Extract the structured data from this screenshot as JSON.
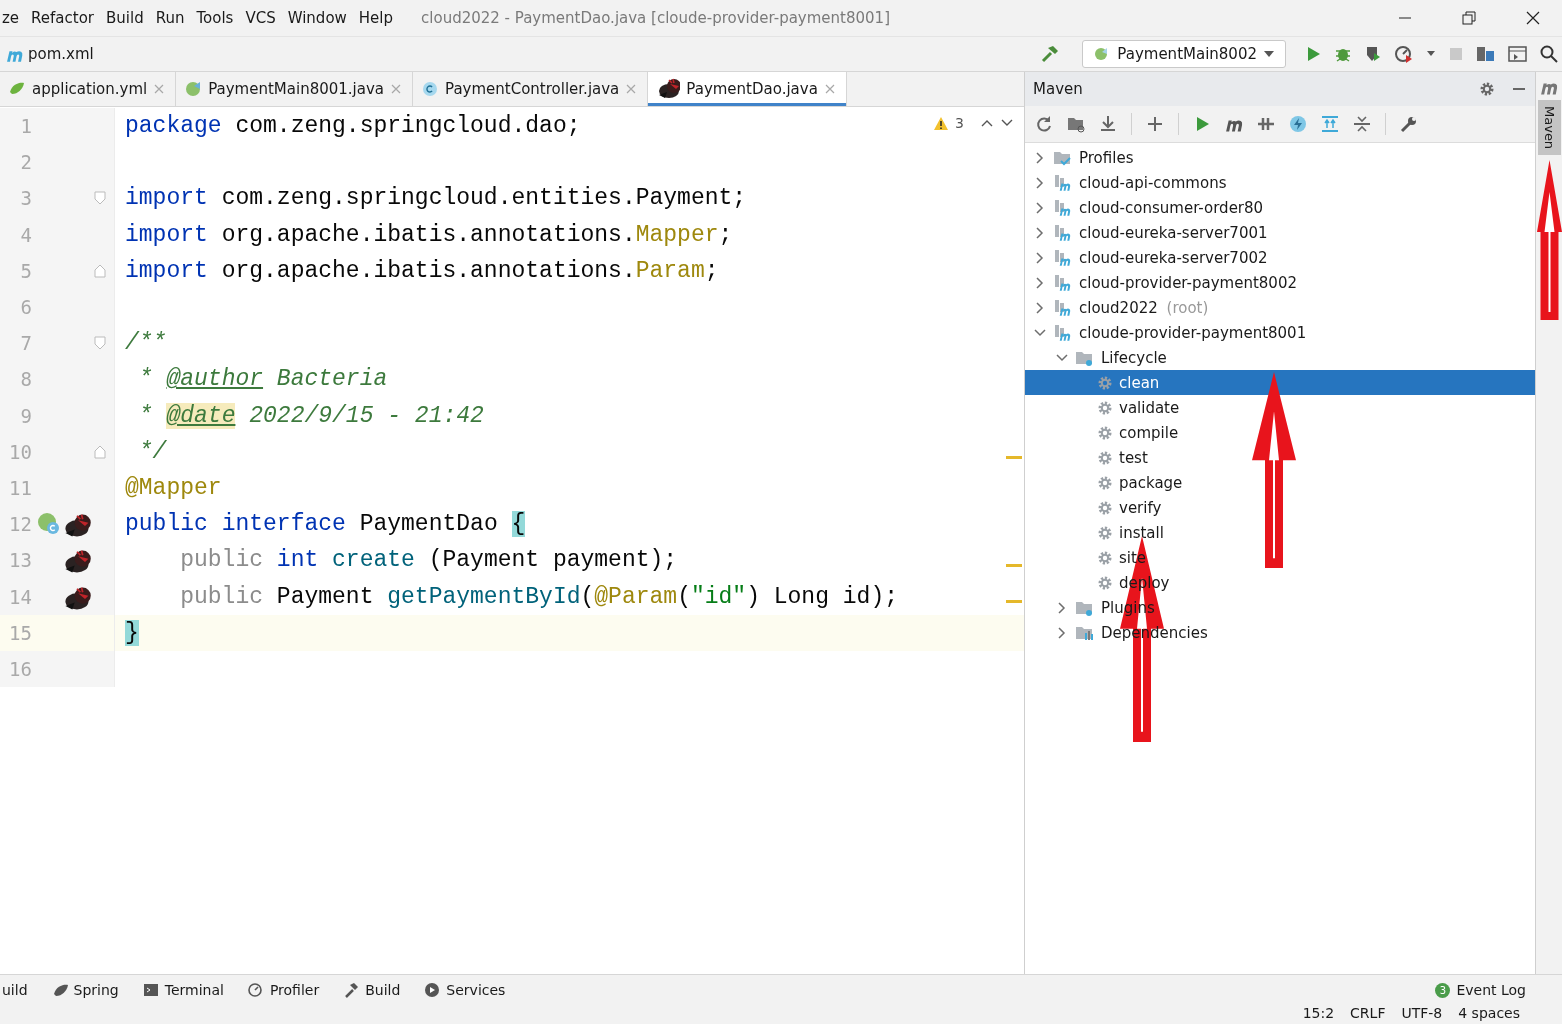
{
  "menu": [
    "ze",
    "Refactor",
    "Build",
    "Run",
    "Tools",
    "VCS",
    "Window",
    "Help"
  ],
  "window": {
    "title": "cloud2022 - PaymentDao.java [cloude-provider-payment8001]"
  },
  "nav": {
    "file": "pom.xml",
    "run_config": "PaymentMain8002"
  },
  "tabs": [
    {
      "label": "application.yml",
      "kind": "yml",
      "selected": false
    },
    {
      "label": "PaymentMain8001.java",
      "kind": "app",
      "selected": false
    },
    {
      "label": "PaymentController.java",
      "kind": "class",
      "selected": false
    },
    {
      "label": "PaymentDao.java",
      "kind": "mapper",
      "selected": true
    }
  ],
  "editor": {
    "warnings": "3",
    "lines": [
      {
        "num": "1",
        "tokens": [
          {
            "t": "package",
            "kind": "kw"
          },
          {
            "t": " com.zeng.springcloud.dao;",
            "kind": "plain"
          }
        ],
        "fold_open": false,
        "fold_close": false,
        "current": false,
        "stripe_mark": false
      },
      {
        "num": "2",
        "fold_open": false,
        "fold_close": false,
        "current": false,
        "stripe_mark": false
      },
      {
        "num": "3",
        "tokens": [
          {
            "t": "import",
            "kind": "kw"
          },
          {
            "t": " com.zeng.springcloud.entities.Payment;",
            "kind": "plain"
          }
        ],
        "fold_open": true,
        "fold_close": false,
        "current": false,
        "stripe_mark": false
      },
      {
        "num": "4",
        "tokens": [
          {
            "t": "import",
            "kind": "kw"
          },
          {
            "t": " org.apache.ibatis.annotations.",
            "kind": "plain"
          },
          {
            "t": "Mapper",
            "kind": "ann"
          },
          {
            "t": ";",
            "kind": "plain"
          }
        ],
        "fold_open": false,
        "fold_close": false,
        "current": false,
        "stripe_mark": false
      },
      {
        "num": "5",
        "tokens": [
          {
            "t": "import",
            "kind": "kw"
          },
          {
            "t": " org.apache.ibatis.annotations.",
            "kind": "plain"
          },
          {
            "t": "Param",
            "kind": "ann"
          },
          {
            "t": ";",
            "kind": "plain"
          }
        ],
        "fold_open": false,
        "fold_close": true,
        "current": false,
        "stripe_mark": false
      },
      {
        "num": "6",
        "fold_open": false,
        "fold_close": false,
        "current": false,
        "stripe_mark": false
      },
      {
        "num": "7",
        "tokens": [
          {
            "t": "/**",
            "kind": "doc"
          }
        ],
        "fold_open": true,
        "fold_close": false,
        "current": false,
        "stripe_mark": false
      },
      {
        "num": "8",
        "tokens": [
          {
            "t": " * ",
            "kind": "doc"
          },
          {
            "t": "@author",
            "kind": "doctag"
          },
          {
            "t": " Bacteria",
            "kind": "doc"
          }
        ],
        "fold_open": false,
        "fold_close": false,
        "current": false,
        "stripe_mark": false
      },
      {
        "num": "9",
        "tokens": [
          {
            "t": " * ",
            "kind": "doc"
          },
          {
            "t": "@date",
            "kind": "doctag-hl"
          },
          {
            "t": " 2022/9/15 - 21:42",
            "kind": "doc"
          }
        ],
        "fold_open": false,
        "fold_close": false,
        "current": false,
        "stripe_mark": false
      },
      {
        "num": "10",
        "tokens": [
          {
            "t": " */",
            "kind": "doc"
          }
        ],
        "fold_open": false,
        "fold_close": true,
        "current": false,
        "stripe_mark": true
      },
      {
        "num": "11",
        "tokens": [
          {
            "t": "@Mapper",
            "kind": "ann"
          }
        ],
        "fold_open": false,
        "fold_close": false,
        "current": false,
        "stripe_mark": false
      },
      {
        "num": "12",
        "tokens": [
          {
            "t": "public ",
            "kind": "kw"
          },
          {
            "t": "interface",
            "kind": "kw"
          },
          {
            "t": " PaymentDao ",
            "kind": "plain"
          },
          {
            "t": "{",
            "kind": "brace"
          }
        ],
        "gutter": [
          {
            "kind": "implemented"
          },
          {
            "kind": "mapper"
          }
        ],
        "fold_open": false,
        "fold_close": false,
        "current": false,
        "stripe_mark": false
      },
      {
        "num": "13",
        "tokens": [
          {
            "t": "    public ",
            "kind": "dim"
          },
          {
            "t": "int ",
            "kind": "kw"
          },
          {
            "t": "create",
            "kind": "method"
          },
          {
            "t": " (Payment payment);",
            "kind": "plain"
          }
        ],
        "gutter": [
          {
            "kind": "mapper"
          }
        ],
        "fold_open": false,
        "fold_close": false,
        "current": false,
        "stripe_mark": true
      },
      {
        "num": "14",
        "tokens": [
          {
            "t": "    public ",
            "kind": "dim"
          },
          {
            "t": "Payment ",
            "kind": "plain"
          },
          {
            "t": "getPaymentById",
            "kind": "method"
          },
          {
            "t": "(",
            "kind": "plain"
          },
          {
            "t": "@Param",
            "kind": "ann"
          },
          {
            "t": "(",
            "kind": "plain"
          },
          {
            "t": "\"id\"",
            "kind": "str"
          },
          {
            "t": ") Long id);",
            "kind": "plain"
          }
        ],
        "gutter": [
          {
            "kind": "mapper"
          }
        ],
        "fold_open": false,
        "fold_close": false,
        "current": false,
        "stripe_mark": true
      },
      {
        "num": "15",
        "tokens": [
          {
            "t": "}",
            "kind": "brace"
          }
        ],
        "fold_open": false,
        "fold_close": false,
        "current": true,
        "stripe_mark": false
      },
      {
        "num": "16",
        "fold_open": false,
        "fold_close": false,
        "current": false,
        "stripe_mark": false
      }
    ]
  },
  "maven": {
    "title": "Maven",
    "tree": [
      {
        "label": "Profiles",
        "kind": "profiles",
        "expanded": false,
        "selected": false
      },
      {
        "label": "cloud-api-commons",
        "kind": "module",
        "expanded": false,
        "selected": false
      },
      {
        "label": "cloud-consumer-order80",
        "kind": "module",
        "expanded": false,
        "selected": false
      },
      {
        "label": "cloud-eureka-server7001",
        "kind": "module",
        "expanded": false,
        "selected": false
      },
      {
        "label": "cloud-eureka-server7002",
        "kind": "module",
        "expanded": false,
        "selected": false
      },
      {
        "label": "cloud-provider-payment8002",
        "kind": "module",
        "expanded": false,
        "selected": false
      },
      {
        "label": "cloud2022",
        "note": "(root)",
        "kind": "module",
        "expanded": false,
        "selected": false
      },
      {
        "label": "cloude-provider-payment8001",
        "kind": "module",
        "expanded": true,
        "selected": false,
        "children": [
          {
            "label": "Lifecycle",
            "kind": "folder",
            "expanded": true,
            "selected": false,
            "children": [
              {
                "label": "clean",
                "kind": "goal",
                "selected": true
              },
              {
                "label": "validate",
                "kind": "goal",
                "selected": false
              },
              {
                "label": "compile",
                "kind": "goal",
                "selected": false
              },
              {
                "label": "test",
                "kind": "goal",
                "selected": false
              },
              {
                "label": "package",
                "kind": "goal",
                "selected": false
              },
              {
                "label": "verify",
                "kind": "goal",
                "selected": false
              },
              {
                "label": "install",
                "kind": "goal",
                "selected": false
              },
              {
                "label": "site",
                "kind": "goal",
                "selected": false
              },
              {
                "label": "deploy",
                "kind": "goal",
                "selected": false
              }
            ]
          },
          {
            "label": "Plugins",
            "kind": "folder",
            "expanded": false,
            "selected": false
          },
          {
            "label": "Dependencies",
            "kind": "deps",
            "expanded": false,
            "selected": false
          }
        ]
      }
    ]
  },
  "side_tab": {
    "label": "Maven",
    "selected": true
  },
  "annotations": [
    {
      "kind": "arrow"
    },
    {
      "kind": "arrow"
    },
    {
      "kind": "arrow"
    }
  ],
  "tool_windows": [
    {
      "label": "uild",
      "kind": "none"
    },
    {
      "label": "Spring",
      "kind": "spring"
    },
    {
      "label": "Terminal",
      "kind": "terminal"
    },
    {
      "label": "Profiler",
      "kind": "profiler"
    },
    {
      "label": "Build",
      "kind": "build"
    },
    {
      "label": "Services",
      "kind": "services"
    }
  ],
  "event_log": {
    "label": "Event Log",
    "count": "3"
  },
  "status": [
    "15:2",
    "CRLF",
    "UTF-8",
    "4 spaces"
  ]
}
